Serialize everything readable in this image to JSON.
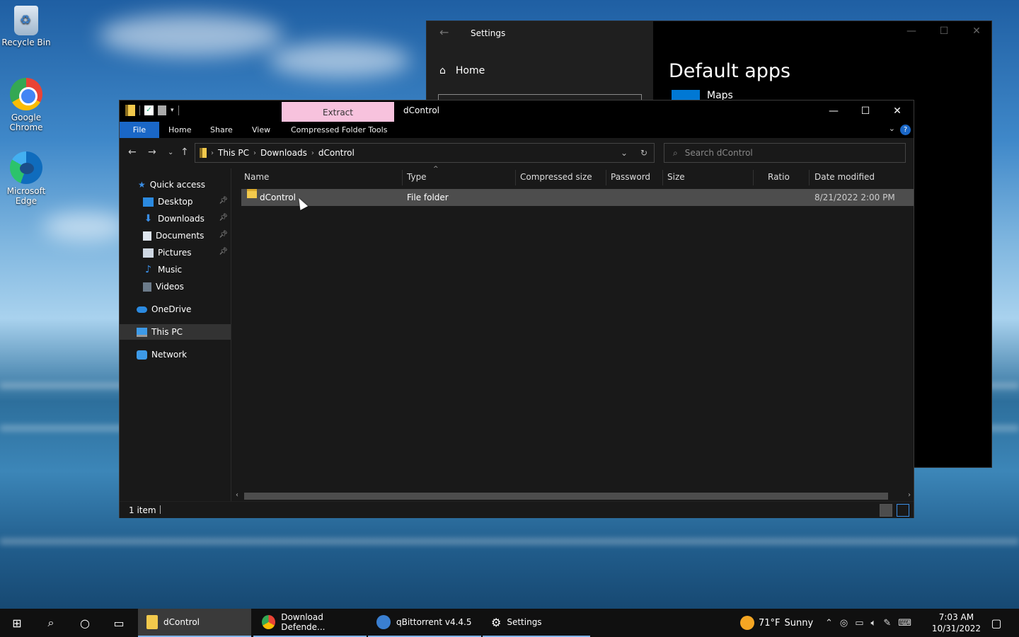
{
  "desktop": {
    "icons": [
      {
        "label": "Recycle Bin"
      },
      {
        "label": "Google Chrome"
      },
      {
        "label": "Microsoft Edge"
      }
    ]
  },
  "settings": {
    "title": "Settings",
    "home_label": "Home",
    "heading": "Default apps",
    "item_label": "Maps"
  },
  "explorer": {
    "title": "dControl",
    "contextual_tab": "Extract",
    "ribbon_tabs": [
      "File",
      "Home",
      "Share",
      "View",
      "Compressed Folder Tools"
    ],
    "breadcrumb": [
      "This PC",
      "Downloads",
      "dControl"
    ],
    "search_placeholder": "Search dControl",
    "nav": {
      "quick_access": "Quick access",
      "pinned": [
        "Desktop",
        "Downloads",
        "Documents",
        "Pictures"
      ],
      "unpinned": [
        "Music",
        "Videos"
      ],
      "onedrive": "OneDrive",
      "this_pc": "This PC",
      "network": "Network"
    },
    "columns": [
      "Name",
      "Type",
      "Compressed size",
      "Password ...",
      "Size",
      "Ratio",
      "Date modified"
    ],
    "rows": [
      {
        "name": "dControl",
        "type": "File folder",
        "date_modified": "8/21/2022 2:00 PM"
      }
    ],
    "status": "1 item"
  },
  "taskbar": {
    "apps": [
      {
        "label": "dControl"
      },
      {
        "label": "Download Defende..."
      },
      {
        "label": "qBittorrent v4.4.5"
      },
      {
        "label": "Settings"
      }
    ],
    "weather": {
      "temp": "71°F",
      "condition": "Sunny"
    },
    "time": "7:03 AM",
    "date": "10/31/2022"
  },
  "colors": {
    "accent": "#1a67c7",
    "extract_tab": "#f7c2dd",
    "selection": "#4d4d4d"
  }
}
